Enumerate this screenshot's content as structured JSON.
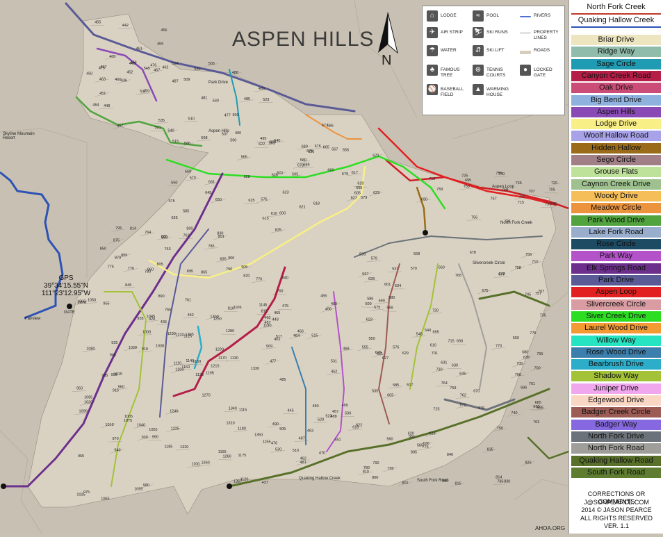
{
  "map": {
    "title": "ASPEN HILLS",
    "north_label": "N",
    "gps_label": "GPS",
    "gps_lat": "39°34'15.55\"N",
    "gps_lon": "111°23'12.95\"W",
    "gate_label": "GATE",
    "fairview_label": "Fairview",
    "skyline_label": "Skyline Mountain Resort",
    "website": "AHOA.ORG",
    "road_labels": [
      "Park Drive",
      "Aspen Loop",
      "North Fork Creek",
      "Silvercreek Circle",
      "Quaking Hallow Creek",
      "South Fork Road",
      "Aspen Hills"
    ],
    "lot_numbers": [
      "436",
      "437",
      "442",
      "445",
      "448",
      "450",
      "451",
      "452",
      "455",
      "456",
      "457",
      "460",
      "461",
      "462",
      "463",
      "464",
      "465",
      "466",
      "467",
      "468",
      "470",
      "475",
      "476",
      "477",
      "480",
      "481",
      "485",
      "487",
      "488",
      "490",
      "495",
      "500",
      "505",
      "509",
      "510",
      "515",
      "517",
      "520",
      "523",
      "530",
      "531",
      "534",
      "535",
      "537",
      "540",
      "545",
      "550",
      "555",
      "560",
      "561",
      "565",
      "567",
      "568",
      "569",
      "570",
      "575",
      "576",
      "579",
      "580",
      "585",
      "586",
      "590",
      "595",
      "600",
      "601",
      "605",
      "610",
      "615",
      "617",
      "618",
      "620",
      "621",
      "622",
      "623",
      "625",
      "626",
      "627",
      "628",
      "629",
      "630",
      "631",
      "635",
      "640",
      "645",
      "650",
      "655",
      "660",
      "665",
      "670",
      "675",
      "676",
      "677",
      "678",
      "679",
      "680",
      "685",
      "686",
      "690",
      "695",
      "700",
      "701",
      "705",
      "707",
      "710",
      "715",
      "720",
      "725",
      "730",
      "735",
      "740",
      "745",
      "750",
      "755",
      "756",
      "757",
      "758",
      "759",
      "760",
      "761",
      "762",
      "763",
      "764",
      "765",
      "770",
      "775",
      "776",
      "780",
      "785",
      "790",
      "795",
      "800",
      "801",
      "805",
      "810",
      "814",
      "815",
      "820",
      "825",
      "830",
      "835",
      "840",
      "845",
      "850",
      "855",
      "860",
      "865",
      "870",
      "875",
      "880",
      "885",
      "890",
      "895",
      "900",
      "905",
      "910",
      "915",
      "920",
      "925",
      "930",
      "935",
      "940",
      "945",
      "950",
      "955",
      "960",
      "965",
      "970",
      "975",
      "980",
      "985",
      "990",
      "995",
      "1000",
      "1005",
      "1010",
      "1015",
      "1020",
      "1025",
      "1030",
      "1038",
      "1040",
      "1045",
      "1050",
      "1055",
      "1060",
      "1065",
      "1070",
      "1075",
      "1080",
      "1085",
      "1090",
      "1095",
      "1100",
      "1106",
      "1110",
      "1115",
      "1120",
      "1125",
      "1130",
      "1135",
      "1140",
      "1145",
      "1150",
      "1155",
      "1160",
      "1165",
      "1170",
      "1175",
      "1180",
      "1185",
      "1190",
      "1195",
      "1200",
      "1205",
      "1210",
      "1215",
      "1225",
      "1230",
      "1240",
      "1250",
      "1260",
      "1270",
      "1280",
      "1290",
      "1300",
      "1310",
      "1320",
      "1330",
      "1340",
      "1350",
      "1360",
      "1367"
    ]
  },
  "icon_legend": {
    "items": [
      {
        "label": "LODGE",
        "icon": "lodge-icon",
        "glyph": "⌂"
      },
      {
        "label": "POOL",
        "icon": "pool-icon",
        "glyph": "≈"
      },
      {
        "label": "RIVERS",
        "icon": "river-line",
        "glyph": ""
      },
      {
        "label": "AIR STRIP",
        "icon": "airplane-icon",
        "glyph": "✈"
      },
      {
        "label": "SKI RUNS",
        "icon": "skier-icon",
        "glyph": "⛷"
      },
      {
        "label": "PROPERTY LINES",
        "icon": "property-line",
        "glyph": ""
      },
      {
        "label": "WATER",
        "icon": "faucet-icon",
        "glyph": "☂"
      },
      {
        "label": "SKI LIFT",
        "icon": "ski-lift-icon",
        "glyph": "⇵"
      },
      {
        "label": "ROADS",
        "icon": "road-line",
        "glyph": ""
      },
      {
        "label": "FAMOUS TREE",
        "icon": "tree-icon",
        "glyph": "♣"
      },
      {
        "label": "TENNIS COURTS",
        "icon": "tennis-icon",
        "glyph": "⊕"
      },
      {
        "label": "LOCKED GATE",
        "icon": "gate-icon",
        "glyph": "●"
      },
      {
        "label": "BASEBALL FIELD",
        "icon": "baseball-icon",
        "glyph": "⚾"
      },
      {
        "label": "WARMING HOUSE",
        "icon": "warming-house-icon",
        "glyph": "▲"
      }
    ]
  },
  "legend": {
    "creeks": [
      {
        "label": "North Fork Creek",
        "color": "#c0392b"
      },
      {
        "label": "Quaking Hallow Creek",
        "color": "#2c52b5"
      }
    ],
    "roads": [
      {
        "label": "Briar Drive",
        "color": "#ede5bf"
      },
      {
        "label": "Ridge Way",
        "color": "#8fbcab"
      },
      {
        "label": "Sage Circle",
        "color": "#1f9bb3"
      },
      {
        "label": "Canyon Creek Road",
        "color": "#b51e47"
      },
      {
        "label": "Oak Drive",
        "color": "#cb4c76"
      },
      {
        "label": "Big Bend Drive",
        "color": "#8fb1de"
      },
      {
        "label": "Aspen Hills",
        "color": "#8a4ab5"
      },
      {
        "label": "Lodge Drive",
        "color": "#f8ef86"
      },
      {
        "label": "Woolf Hallow Road",
        "color": "#a8a3e9"
      },
      {
        "label": "Hidden Hallow",
        "color": "#9a6c1a"
      },
      {
        "label": "Sego Circle",
        "color": "#a17f86"
      },
      {
        "label": "Grouse Flats",
        "color": "#bfe29a"
      },
      {
        "label": "Caynon Creek Drive",
        "color": "#9ec18f"
      },
      {
        "label": "Woody Drive",
        "color": "#f6be58"
      },
      {
        "label": "Meadow Circle",
        "color": "#ec933e"
      },
      {
        "label": "Park Wood Drive",
        "color": "#51a33e"
      },
      {
        "label": "Lake Fork Road",
        "color": "#99aecd"
      },
      {
        "label": "Rose Circle",
        "color": "#1c4b63"
      },
      {
        "label": "Park Way",
        "color": "#b352c9"
      },
      {
        "label": "Elk Springs Road",
        "color": "#6d2f8c"
      },
      {
        "label": "Park Drive",
        "color": "#5a5a96"
      },
      {
        "label": "Aspen Loop",
        "color": "#e32021"
      },
      {
        "label": "Slivercreek Circle",
        "color": "#d99ca2"
      },
      {
        "label": "Siver Creek Drive",
        "color": "#2ddd22"
      },
      {
        "label": "Laurel Wood Drive",
        "color": "#f39a32"
      },
      {
        "label": "Willow Way",
        "color": "#26e3c1"
      },
      {
        "label": "Rose Wood Drive",
        "color": "#3c7fad"
      },
      {
        "label": "Bearbrush Drive",
        "color": "#2cadc9"
      },
      {
        "label": "Shadow Way",
        "color": "#a3c238"
      },
      {
        "label": "Juniper Drive",
        "color": "#f1a7ee"
      },
      {
        "label": "Edgewood Drive",
        "color": "#fad6c4"
      },
      {
        "label": "Badger Creek Circle",
        "color": "#9c5b55"
      },
      {
        "label": "Badger Way",
        "color": "#8669e0"
      },
      {
        "label": "North Fork Drive",
        "color": "#6c7279"
      },
      {
        "label": "North Fork Road",
        "color": "#a09e9a"
      },
      {
        "label": "Quaking Hallow Road",
        "color": "#58702a"
      },
      {
        "label": "South Fork Road",
        "color": "#5e7d31"
      }
    ],
    "footer": [
      "CORRECTIONS OR COMMENTS",
      "J@SONPEARCE.COM",
      "2014 © JASON PEARCE",
      "ALL RIGHTS RESERVED",
      "VER. 1.1"
    ]
  }
}
